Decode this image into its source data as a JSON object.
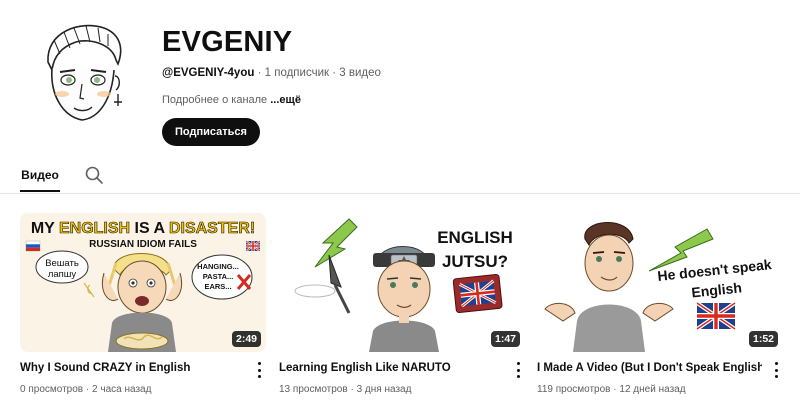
{
  "channel": {
    "name": "EVGENIY",
    "handle": "@EVGENIY-4you",
    "subscribers": "1 подписчик",
    "videos_count": "3 видео",
    "separator": "·",
    "about_text": "Подробнее о канале",
    "about_more": "...ещё",
    "subscribe_label": "Подписаться"
  },
  "tabs": {
    "videos_label": "Видео"
  },
  "videos": [
    {
      "title": "Why I Sound CRAZY in English",
      "views": "0 просмотров",
      "age": "2 часа назад",
      "duration": "2:49",
      "thumb": {
        "headline_1": "MY ",
        "headline_2": "ENGLISH",
        "headline_3": " IS A ",
        "headline_4": "DISASTER!",
        "subline": "RUSSIAN IDIOM FAILS",
        "bubble_left_1": "Вешать",
        "bubble_left_2": "лапшу",
        "bubble_right_1": "HANGING...",
        "bubble_right_2": "PASTA...",
        "bubble_right_3": "EARS..."
      }
    },
    {
      "title": "Learning English Like NARUTO",
      "views": "13 просмотров",
      "age": "3 дня назад",
      "duration": "1:47",
      "thumb": {
        "text_1": "ENGLISH",
        "text_2": "JUTSU?"
      }
    },
    {
      "title": "I Made A Video (But I Don't Speak English)",
      "views": "119 просмотров",
      "age": "12 дней назад",
      "duration": "1:52",
      "thumb": {
        "text_1": "He doesn't speak",
        "text_2": "English"
      }
    }
  ],
  "colors": {
    "text_primary": "#0f0f0f",
    "text_secondary": "#606060",
    "accent_yellow": "#f5c400",
    "arrow_green": "#8cc84b"
  }
}
